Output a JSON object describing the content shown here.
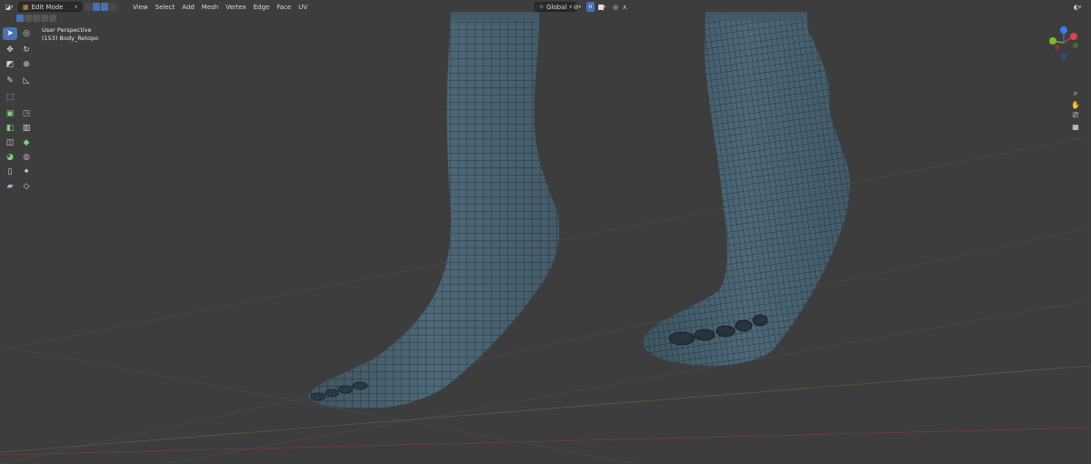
{
  "header": {
    "mode_label": "Edit Mode",
    "menus": [
      "View",
      "Select",
      "Add",
      "Mesh",
      "Vertex",
      "Edge",
      "Face",
      "UV"
    ],
    "orientation_label": "Global"
  },
  "overlay": {
    "view_name": "User Perspective",
    "object_name": "(153) Body_Retopo"
  },
  "icons": {
    "editor_type": "cube-icon",
    "mode": "edit-mode-icon",
    "toolbar": [
      "cursor-select-icon",
      "3d-cursor-icon",
      "move-icon",
      "rotate-icon",
      "scale-icon",
      "transform-icon",
      "annotate-icon",
      "measure-icon",
      "add-cube-icon",
      "extrude-icon",
      "inset-icon",
      "bevel-icon",
      "loop-cut-icon",
      "knife-icon",
      "poly-build-icon",
      "spin-icon",
      "smooth-icon",
      "edge-slide-icon",
      "shrink-fatten-icon",
      "shear-icon",
      "rip-icon"
    ],
    "nav": [
      "zoom-icon",
      "hand-pan-icon",
      "camera-icon",
      "grid-icon"
    ]
  },
  "colors": {
    "viewport_bg": "#3d3d3d",
    "mesh_fill": "#4d6878",
    "wire": "#1b2730",
    "active_blue": "#4772b3",
    "axis_x": "#e0404f",
    "axis_y": "#7fbb27",
    "axis_z": "#3c7de8"
  }
}
